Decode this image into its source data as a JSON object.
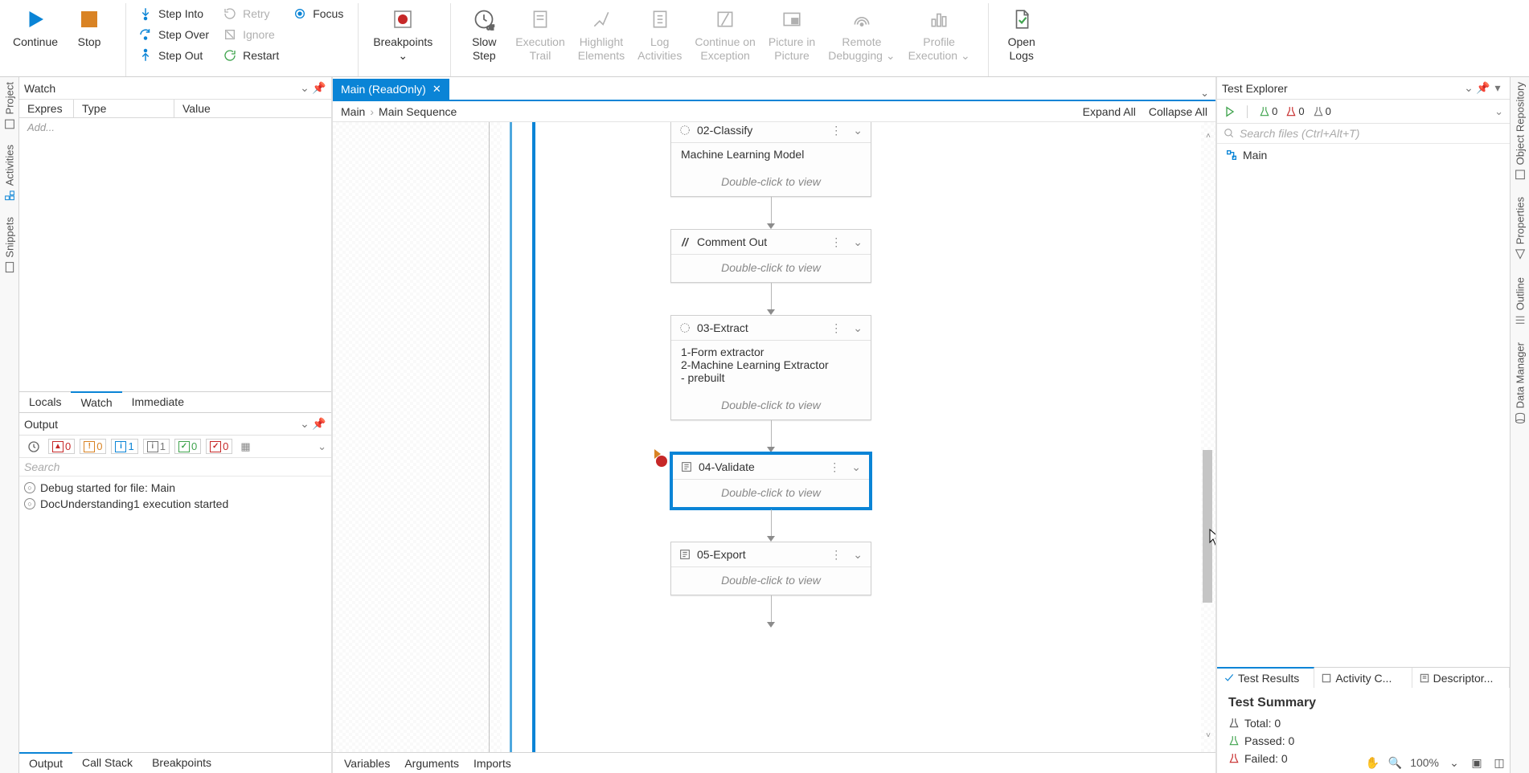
{
  "ribbon": {
    "continue": "Continue",
    "stop": "Stop",
    "step_into": "Step Into",
    "step_over": "Step Over",
    "step_out": "Step Out",
    "retry": "Retry",
    "ignore": "Ignore",
    "restart": "Restart",
    "focus": "Focus",
    "breakpoints": "Breakpoints",
    "slow_step": "Slow\nStep",
    "exec_trail": "Execution\nTrail",
    "highlight": "Highlight\nElements",
    "log_acts": "Log\nActivities",
    "cont_exc": "Continue on\nException",
    "pip": "Picture in\nPicture",
    "remote_dbg": "Remote\nDebugging",
    "profile_exec": "Profile\nExecution",
    "open_logs": "Open\nLogs"
  },
  "left_rail": [
    "Project",
    "Activities",
    "Snippets"
  ],
  "right_rail": [
    "Object Repository",
    "Properties",
    "Outline",
    "Data Manager"
  ],
  "watch": {
    "title": "Watch",
    "cols": [
      "Expres",
      "Type",
      "Value"
    ],
    "add": "Add...",
    "tabs": [
      "Locals",
      "Watch",
      "Immediate"
    ],
    "active_tab": "Watch"
  },
  "output": {
    "title": "Output",
    "filters": {
      "time": "",
      "err": "0",
      "warn": "0",
      "info_blue": "1",
      "info_gray": "1",
      "ok": "0",
      "x": "0"
    },
    "search": "Search",
    "rows": [
      "Debug started for file: Main",
      "DocUnderstanding1 execution started"
    ],
    "tabs": [
      "Output",
      "Call Stack",
      "Breakpoints"
    ],
    "active_tab": "Output"
  },
  "doc": {
    "tab_name": "Main (ReadOnly)",
    "breadcrumb": [
      "Main",
      "Main Sequence"
    ],
    "expand_all": "Expand All",
    "collapse_all": "Collapse All"
  },
  "activities": {
    "classify": {
      "title": "02-Classify",
      "desc": "Machine Learning Model",
      "hint": "Double-click to view"
    },
    "comment": {
      "title": "Comment Out",
      "hint": "Double-click to view"
    },
    "extract": {
      "title": "03-Extract",
      "l1": "1-Form extractor",
      "l2": "2-Machine Learning Extractor",
      "l3": "- prebuilt",
      "hint": "Double-click to view"
    },
    "validate": {
      "title": "04-Validate",
      "hint": "Double-click to view"
    },
    "export": {
      "title": "05-Export",
      "hint": "Double-click to view"
    }
  },
  "designer_tabs": [
    "Variables",
    "Arguments",
    "Imports"
  ],
  "test_explorer": {
    "title": "Test Explorer",
    "counters": {
      "pass": "0",
      "fail": "0",
      "not_run": "0"
    },
    "search_placeholder": "Search files (Ctrl+Alt+T)",
    "tree_root": "Main",
    "result_tabs": [
      "Test Results",
      "Activity C...",
      "Descriptor..."
    ],
    "active_tab": "Test Results",
    "summary_title": "Test Summary",
    "total": "Total: 0",
    "passed": "Passed: 0",
    "failed": "Failed: 0"
  },
  "zoom": "100%"
}
